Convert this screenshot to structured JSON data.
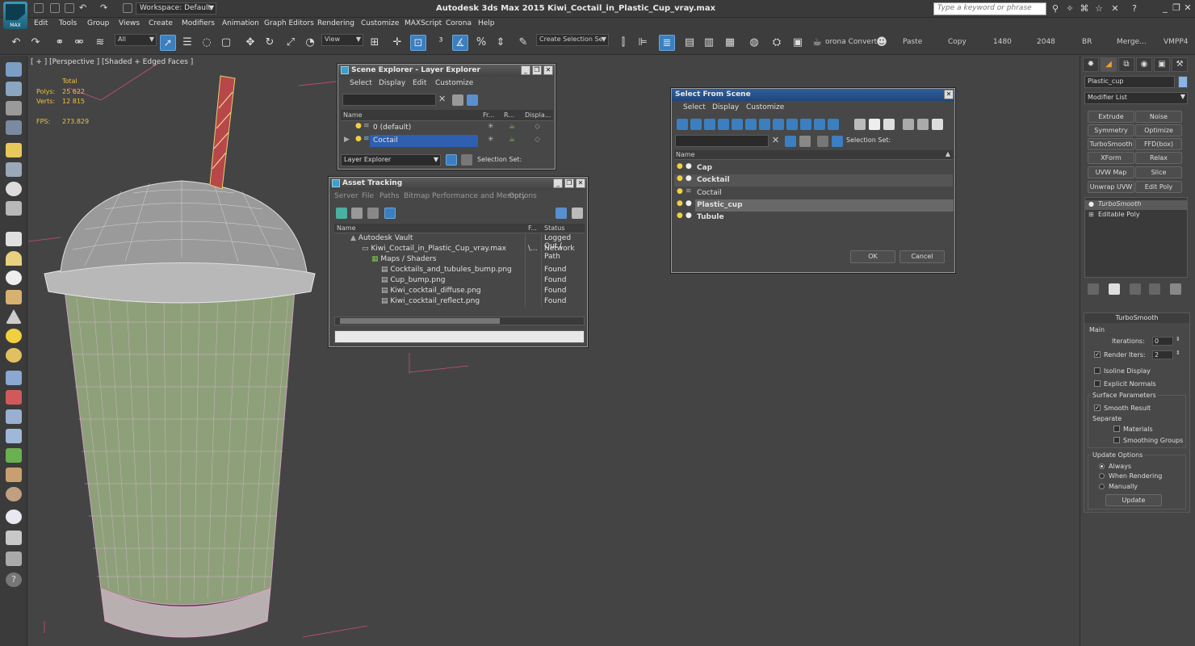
{
  "title": {
    "workspace": "Workspace: Default",
    "app_title": "Autodesk 3ds Max  2015     Kiwi_Coctail_in_Plastic_Cup_vray.max",
    "search_placeholder": "Type a keyword or phrase",
    "max_logo_label": "MAX"
  },
  "menu": [
    "Edit",
    "Tools",
    "Group",
    "Views",
    "Create",
    "Modifiers",
    "Animation",
    "Graph Editors",
    "Rendering",
    "Customize",
    "MAXScript",
    "Corona",
    "Help"
  ],
  "toolbar": {
    "filter": "All",
    "ref_coord": "View",
    "sel_set": "Create Selection Se",
    "corona_convert": "orona Convert",
    "paste": "Paste",
    "copy": "Copy",
    "res1": "1480",
    "res2": "2048",
    "br": "BR",
    "merge": "Merge...",
    "vmpp": "VMPP4"
  },
  "viewport": {
    "label": "[ + ] [Perspective ] [Shaded + Edged Faces ]",
    "total_label": "Total",
    "polys_label": "Polys:",
    "polys": "25 622",
    "verts_label": "Verts:",
    "verts": "12 815",
    "fps_label": "FPS:",
    "fps": "273.829"
  },
  "scene_explorer": {
    "title": "Scene Explorer - Layer Explorer",
    "menu": [
      "Select",
      "Display",
      "Edit",
      "Customize"
    ],
    "columns": [
      "Name",
      "Fr...",
      "R...",
      "Displa..."
    ],
    "rows": [
      "0 (default)",
      "Coctail"
    ],
    "footer_dropdown": "Layer Explorer",
    "selection_set": "Selection Set:"
  },
  "asset_tracking": {
    "title": "Asset Tracking",
    "menu": [
      "Server",
      "File",
      "Paths",
      "Bitmap Performance and Memory",
      "Options"
    ],
    "columns": [
      "Name",
      "F...",
      "Status"
    ],
    "rows": [
      {
        "name": "Autodesk Vault",
        "f": "",
        "status": "Logged Out ("
      },
      {
        "name": "Kiwi_Coctail_in_Plastic_Cup_vray.max",
        "f": "\\...",
        "status": "Network Path"
      },
      {
        "name": "Maps / Shaders",
        "f": "",
        "status": ""
      },
      {
        "name": "Cocktails_and_tubules_bump.png",
        "f": "",
        "status": "Found"
      },
      {
        "name": "Cup_bump.png",
        "f": "",
        "status": "Found"
      },
      {
        "name": "Kiwi_cocktail_diffuse.png",
        "f": "",
        "status": "Found"
      },
      {
        "name": "Kiwi_cocktail_reflect.png",
        "f": "",
        "status": "Found"
      }
    ]
  },
  "select_from_scene": {
    "title": "Select From Scene",
    "menu": [
      "Select",
      "Display",
      "Customize"
    ],
    "selection_set": "Selection Set:",
    "column": "Name",
    "rows": [
      "Cap",
      "Cocktail",
      "Coctail",
      "Plastic_cup",
      "Tubule"
    ],
    "ok": "OK",
    "cancel": "Cancel"
  },
  "command_panel": {
    "object_name": "Plastic_cup",
    "color": "#88b4e8",
    "modifier_list": "Modifier List",
    "modifier_buttons": [
      "Extrude",
      "Noise",
      "Symmetry",
      "Optimize",
      "TurboSmooth",
      "FFD(box)",
      "XForm",
      "Relax",
      "UVW Map",
      "Slice",
      "Unwrap UVW",
      "Edit Poly"
    ],
    "stack": [
      "TurboSmooth",
      "Editable Poly"
    ],
    "rollout": {
      "title": "TurboSmooth",
      "main": "Main",
      "iterations_label": "Iterations:",
      "iterations": "0",
      "render_iters_label": "Render Iters:",
      "render_iters": "2",
      "isoline": "Isoline Display",
      "explicit_normals": "Explicit Normals",
      "surface_params": "Surface Parameters",
      "smooth_result": "Smooth Result",
      "separate": "Separate",
      "materials": "Materials",
      "smoothing_groups": "Smoothing Groups",
      "update_options": "Update Options",
      "always": "Always",
      "when_rendering": "When Rendering",
      "manually": "Manually",
      "update_button": "Update"
    }
  }
}
